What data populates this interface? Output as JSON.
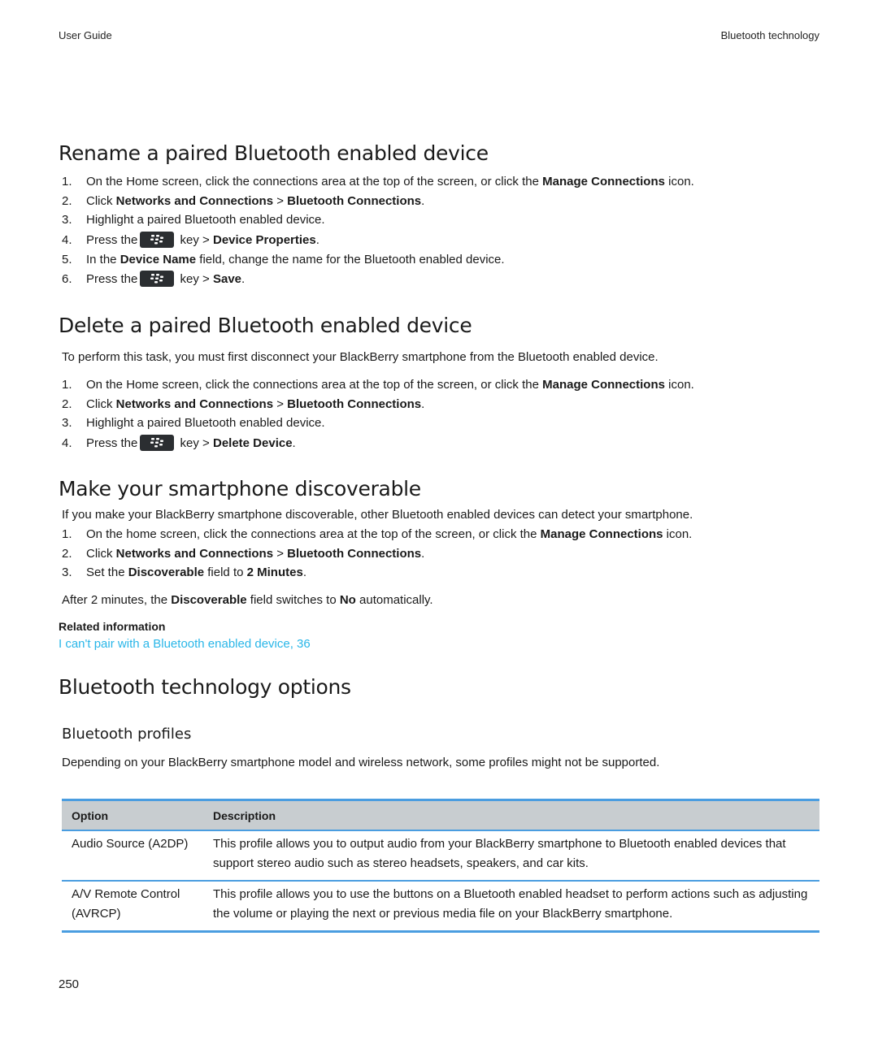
{
  "header": {
    "left": "User Guide",
    "right": "Bluetooth technology"
  },
  "sections": {
    "rename": {
      "title": "Rename a paired Bluetooth enabled device",
      "steps": [
        {
          "num": "1.",
          "pre": "On the Home screen, click the connections area at the top of the screen, or click the ",
          "bold1": "Manage Connections",
          "post": " icon."
        },
        {
          "num": "2.",
          "pre": "Click ",
          "bold1": "Networks and Connections",
          "mid": " > ",
          "bold2": "Bluetooth Connections",
          "post": "."
        },
        {
          "num": "3.",
          "pre": "Highlight a paired Bluetooth enabled device."
        },
        {
          "num": "4.",
          "pre": "Press the",
          "key": "blackberry-menu-key",
          "mid": " key > ",
          "bold1": "Device Properties",
          "post": "."
        },
        {
          "num": "5.",
          "pre": "In the ",
          "bold1": "Device Name",
          "post": " field, change the name for the Bluetooth enabled device."
        },
        {
          "num": "6.",
          "pre": "Press the",
          "key": "blackberry-menu-key",
          "mid": " key > ",
          "bold1": "Save",
          "post": "."
        }
      ]
    },
    "delete": {
      "title": "Delete a paired Bluetooth enabled device",
      "intro": "To perform this task, you must first disconnect your BlackBerry smartphone from the Bluetooth enabled device.",
      "steps": [
        {
          "num": "1.",
          "pre": "On the Home screen, click the connections area at the top of the screen, or click the ",
          "bold1": "Manage Connections",
          "post": " icon."
        },
        {
          "num": "2.",
          "pre": "Click ",
          "bold1": "Networks and Connections",
          "mid": " > ",
          "bold2": "Bluetooth Connections",
          "post": "."
        },
        {
          "num": "3.",
          "pre": "Highlight a paired Bluetooth enabled device."
        },
        {
          "num": "4.",
          "pre": "Press the",
          "key": "blackberry-menu-key",
          "mid": " key > ",
          "bold1": "Delete Device",
          "post": "."
        }
      ]
    },
    "discoverable": {
      "title": "Make your smartphone discoverable",
      "intro": "If you make your BlackBerry smartphone discoverable, other Bluetooth enabled devices can detect your smartphone.",
      "steps": [
        {
          "num": "1.",
          "pre": "On the home screen, click the connections area at the top of the screen, or click the ",
          "bold1": "Manage Connections",
          "post": " icon."
        },
        {
          "num": "2.",
          "pre": "Click ",
          "bold1": "Networks and Connections",
          "mid": " > ",
          "bold2": "Bluetooth Connections",
          "post": "."
        },
        {
          "num": "3.",
          "pre": "Set the ",
          "bold1": "Discoverable",
          "mid": " field to ",
          "bold2": "2 Minutes",
          "post": "."
        }
      ],
      "after": {
        "pre": "After 2 minutes, the ",
        "bold1": "Discoverable",
        "mid": " field switches to ",
        "bold2": "No",
        "post": " automatically."
      },
      "related_header": "Related information",
      "related_link": "I can't pair with a Bluetooth enabled device, 36"
    },
    "options": {
      "title": "Bluetooth technology options",
      "subtitle": "Bluetooth profiles",
      "intro": "Depending on your BlackBerry smartphone model and wireless network, some profiles might not be supported.",
      "table": {
        "headers": [
          "Option",
          "Description"
        ],
        "rows": [
          {
            "option": "Audio Source (A2DP)",
            "description": "This profile allows you to output audio from your BlackBerry smartphone to Bluetooth enabled devices that support stereo audio such as stereo headsets, speakers, and car kits."
          },
          {
            "option": "A/V Remote Control (AVRCP)",
            "description": "This profile allows you to use the buttons on a Bluetooth enabled headset to perform actions such as adjusting the volume or playing the next or previous media file on your BlackBerry smartphone."
          }
        ]
      }
    }
  },
  "page_number": "250",
  "colors": {
    "link": "#29b6e8",
    "table_rule": "#4a9de0",
    "table_header_bg": "#c8cdd0",
    "key_bg": "#2b2e31"
  }
}
